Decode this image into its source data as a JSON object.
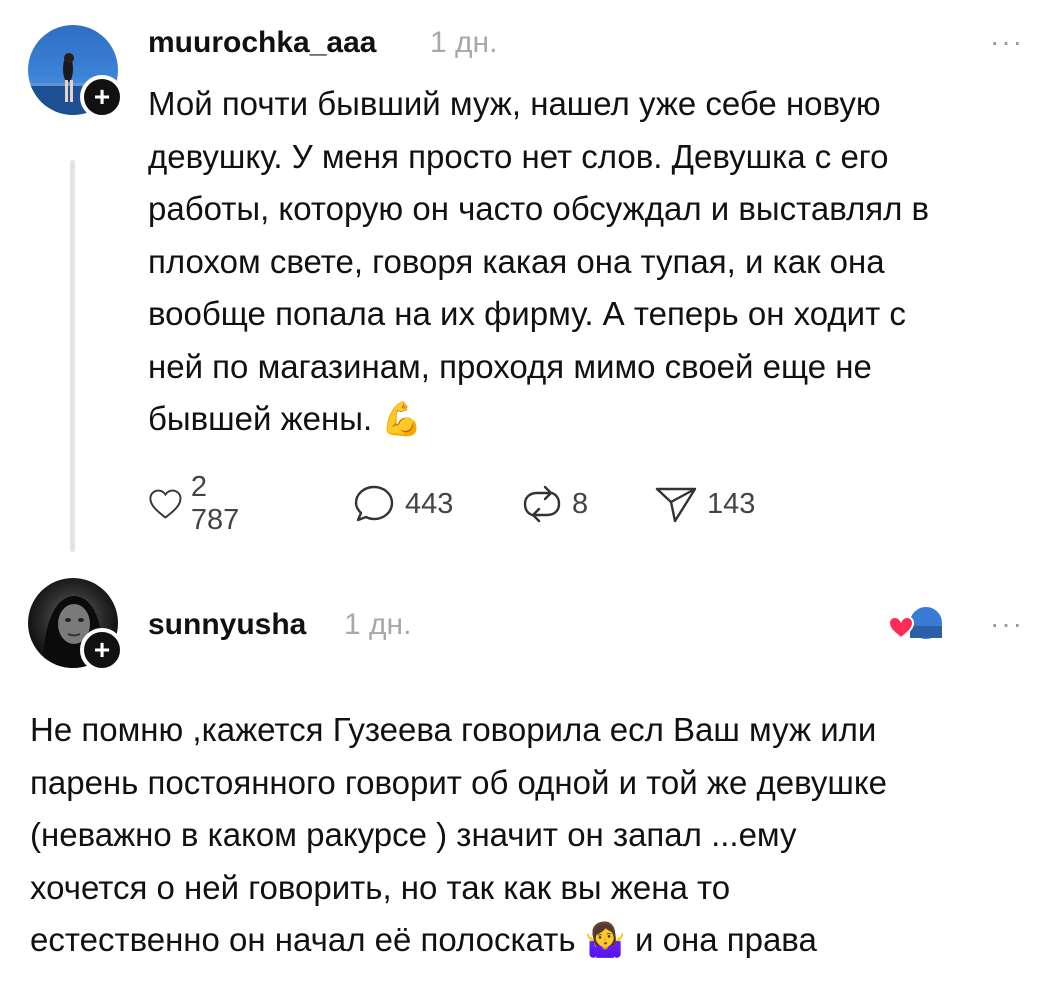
{
  "post": {
    "username": "muurochka_aaa",
    "time": "1 дн.",
    "more": "···",
    "lines": [
      "Мой почти бывший муж, нашел уже себе новую",
      "девушку. У меня просто нет слов. Девушка с его",
      "работы, которую он часто обсуждал и выставлял в",
      "плохом свете, говоря какая она тупая, и как она",
      "вообще попала на их фирму. А теперь он ходит с",
      "ней по магазинам, проходя мимо своей еще не",
      "бывшей жены."
    ],
    "emoji": "💪",
    "actions": {
      "likes": "2 787",
      "comments": "443",
      "reposts": "8",
      "shares": "143"
    }
  },
  "reply": {
    "username": "sunnyusha",
    "time": "1 дн.",
    "more": "···",
    "lines": [
      "Не помню ,кажется Гузеева говорила есл Ваш муж или",
      "парень постоянного говорит об одной и той же девушке",
      "(неважно в каком ракурсе ) значит он запал ...ему",
      "хочется о ней говорить, но так как вы жена то",
      "естественно он начал её полоскать"
    ],
    "emoji": "🤷‍♀️",
    "tail": "и она права"
  },
  "icons": {
    "follow": "plus-icon",
    "like": "heart-icon",
    "comment": "comment-icon",
    "repost": "repost-icon",
    "share": "send-icon",
    "reaction": "heart-reaction-icon"
  }
}
